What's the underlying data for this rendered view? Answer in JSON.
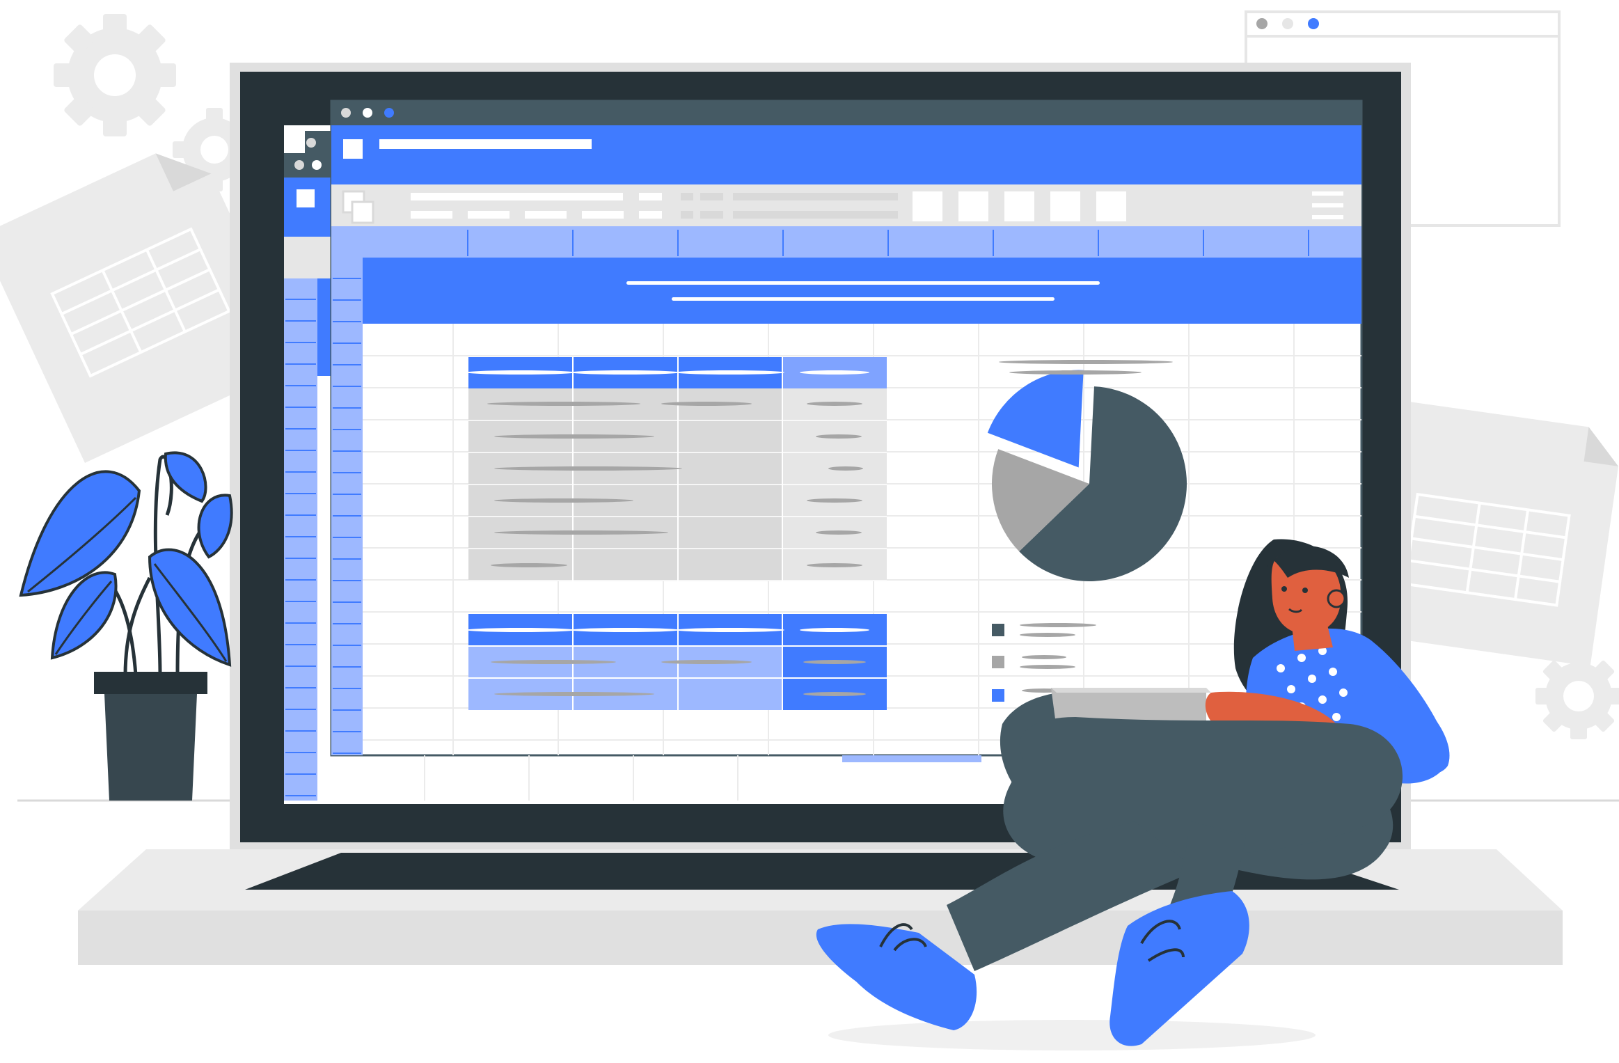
{
  "palette": {
    "accent": "#407bff",
    "accent_light": "#9db8ff",
    "accent_mid": "#7fa3ff",
    "dark": "#263238",
    "slate": "#455a64",
    "grey": "#a6a6a6",
    "light_grey": "#e6e6e6",
    "skin": "#e0603f",
    "hair": "#263238"
  },
  "icons": {
    "gear": "gear-icon",
    "document": "spreadsheet-document-icon",
    "window_controls": "window-dots-icon"
  },
  "chart_data": {
    "type": "pie",
    "values": [
      62,
      18,
      20
    ],
    "colors": [
      "#455a64",
      "#a6a6a6",
      "#407bff"
    ],
    "exploded_index": 2
  },
  "window_dots": {
    "main": [
      "#d9d9d9",
      "#ffffff",
      "#407bff"
    ],
    "back": [
      "#d9d9d9",
      "#ffffff"
    ],
    "top_right": [
      "#a6a6a6",
      "#e6e6e6",
      "#407bff"
    ]
  }
}
